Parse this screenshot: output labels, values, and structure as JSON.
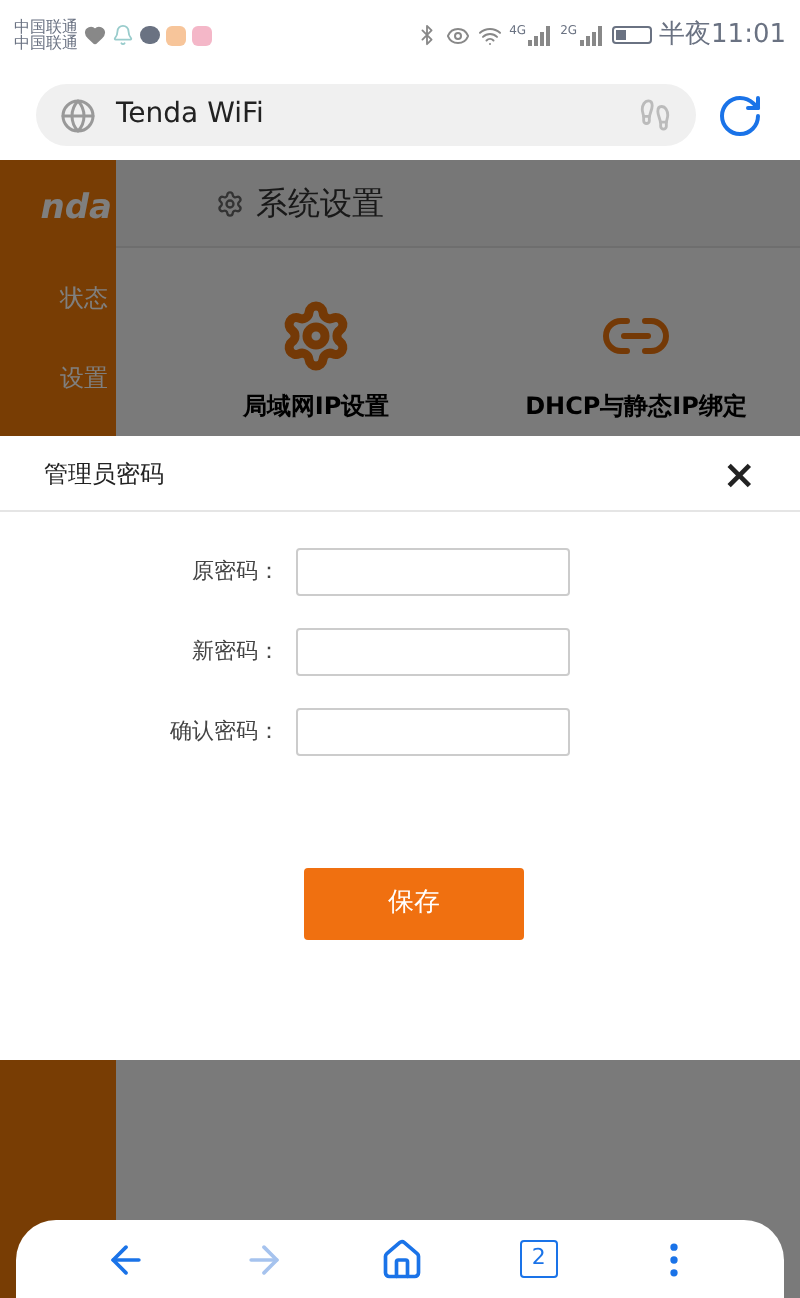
{
  "status_bar": {
    "carriers": [
      "中国联通",
      "中国联通"
    ],
    "network_labels": [
      "4G",
      "2G"
    ],
    "time": "半夜11:01"
  },
  "browser": {
    "address": "Tenda WiFi",
    "tab_count": "2"
  },
  "page": {
    "logo": "nda",
    "sidebar_items": [
      "状态",
      "设置"
    ],
    "section_title": "系统设置",
    "tiles": [
      {
        "kind": "ip",
        "label": "局域网IP设置"
      },
      {
        "kind": "link",
        "label": "DHCP与静态IP绑定"
      }
    ]
  },
  "dialog": {
    "title": "管理员密码",
    "close": "×",
    "fields": [
      {
        "label": "原密码："
      },
      {
        "label": "新密码："
      },
      {
        "label": "确认密码："
      }
    ],
    "save_button": "保存"
  }
}
